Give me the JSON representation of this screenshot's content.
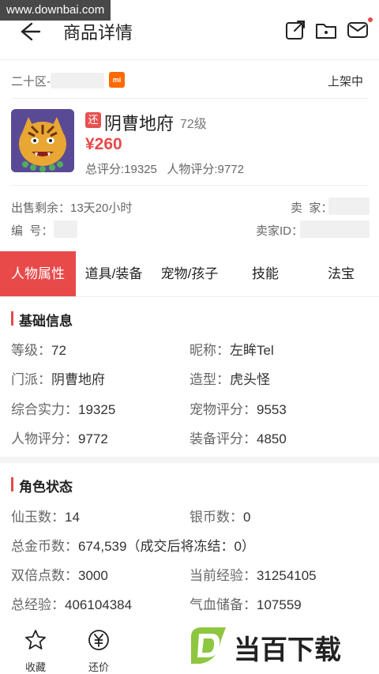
{
  "watermark_top": "www.downbai.com",
  "header": {
    "title": "商品详情"
  },
  "server": {
    "name": "二十区-",
    "badge": "mi",
    "status": "上架中"
  },
  "role": {
    "refund_badge": "还",
    "name": "阴曹地府",
    "level": "72级",
    "price": "¥260",
    "scores": "总评分:19325   人物评分:9772"
  },
  "meta": {
    "remaining_label": "出售剩余：13天20小时",
    "seller_label": "卖  家：",
    "id_label": "编  号：",
    "seller_id_label": "卖家ID："
  },
  "tabs": [
    "人物属性",
    "道具/装备",
    "宠物/孩子",
    "技能",
    "法宝"
  ],
  "basic": {
    "title": "基础信息",
    "rows": [
      [
        "等级：",
        "72",
        "昵称：",
        "左眸Tel"
      ],
      [
        "门派：",
        "阴曹地府",
        "造型：",
        "虎头怪"
      ],
      [
        "综合实力：",
        "19325",
        "宠物评分：",
        "9553"
      ],
      [
        "人物评分：",
        "9772",
        "装备评分：",
        "4850"
      ]
    ]
  },
  "status": {
    "title": "角色状态",
    "row1": [
      "仙玉数：",
      "14",
      "银币数：",
      "0"
    ],
    "gold": [
      "总金币数：",
      "674,539（成交后将冻结：0）"
    ],
    "row3": [
      "双倍点数：",
      "3000",
      "当前经验：",
      "31254105"
    ],
    "row4": [
      "总经验：",
      "406104384",
      "气血储备：",
      "107559"
    ]
  },
  "bottom": {
    "fav": "收藏",
    "offer": "还价"
  },
  "watermark_logo": "当百下载",
  "colors": {
    "accent": "#e84a4a",
    "mi": "#ff6a00"
  }
}
